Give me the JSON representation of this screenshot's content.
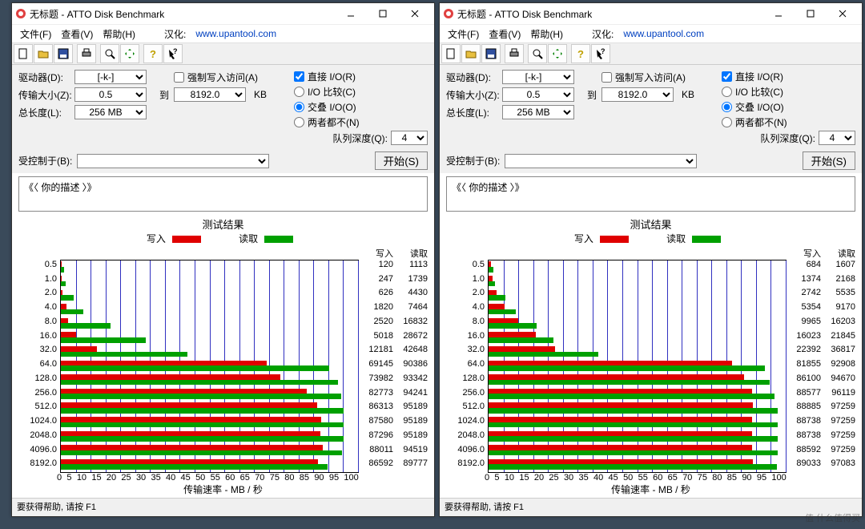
{
  "watermark": "值 什么值得买",
  "title": "无标题 - ATTO Disk Benchmark",
  "menu": {
    "file": "文件(F)",
    "view": "查看(V)",
    "help": "帮助(H)",
    "cn": "汉化:",
    "url": "www.upantool.com"
  },
  "form": {
    "driver_lbl": "驱动器(D):",
    "driver": "[-k-]",
    "force_lbl": "强制写入访问(A)",
    "force": false,
    "direct_lbl": "直接 I/O(R)",
    "direct": true,
    "size_lbl": "传输大小(Z):",
    "size_from": "0.5",
    "to_lbl": "到",
    "size_to": "8192.0",
    "kb": "KB",
    "len_lbl": "总长度(L):",
    "len": "256 MB",
    "io_cmp": "I/O 比较(C)",
    "io_ovl": "交叠 I/O(O)",
    "io_nei": "两者都不(N)",
    "io_sel": "io_ovl",
    "queue_lbl": "队列深度(Q):",
    "queue": "4",
    "limit_lbl": "受控制于(B):",
    "limit": "",
    "start": "开始(S)",
    "desc": "《〈  你的描述   〉》"
  },
  "result": {
    "title": "测试结果",
    "write": "写入",
    "read": "读取",
    "xlab": "传输速率 - MB / 秒",
    "hdr_w": "写入",
    "hdr_r": "读取"
  },
  "status": "要获得帮助, 请按 F1",
  "toolbar_icons": [
    "file-new",
    "file-open",
    "file-save",
    "print",
    "search",
    "move",
    "help",
    "whats-this"
  ],
  "chart_data": [
    {
      "type": "bar",
      "xlabel": "传输速率 - MB / 秒",
      "xlim": [
        0,
        100
      ],
      "xticks": [
        0,
        5,
        10,
        15,
        20,
        25,
        30,
        35,
        40,
        45,
        50,
        55,
        60,
        65,
        70,
        75,
        80,
        85,
        90,
        95,
        100
      ],
      "categories": [
        "0.5",
        "1.0",
        "2.0",
        "4.0",
        "8.0",
        "16.0",
        "32.0",
        "64.0",
        "128.0",
        "256.0",
        "512.0",
        "1024.0",
        "2048.0",
        "4096.0",
        "8192.0"
      ],
      "y_unit": "KB block size",
      "series": [
        {
          "name": "写入",
          "color": "#e00000",
          "unit": "KB/s",
          "values": [
            120,
            247,
            626,
            1820,
            2520,
            5018,
            12181,
            69145,
            73982,
            82773,
            86313,
            87580,
            87296,
            88011,
            86592
          ]
        },
        {
          "name": "读取",
          "color": "#00a000",
          "unit": "KB/s",
          "values": [
            1113,
            1739,
            4430,
            7464,
            16832,
            28672,
            42648,
            90386,
            93342,
            94241,
            95189,
            95189,
            95189,
            94519,
            89777
          ]
        }
      ],
      "bar_scale_max_kbps": 100000
    },
    {
      "type": "bar",
      "xlabel": "传输速率 - MB / 秒",
      "xlim": [
        0,
        100
      ],
      "xticks": [
        0,
        5,
        10,
        15,
        20,
        25,
        30,
        35,
        40,
        45,
        50,
        55,
        60,
        65,
        70,
        75,
        80,
        85,
        90,
        95,
        100
      ],
      "categories": [
        "0.5",
        "1.0",
        "2.0",
        "4.0",
        "8.0",
        "16.0",
        "32.0",
        "64.0",
        "128.0",
        "256.0",
        "512.0",
        "1024.0",
        "2048.0",
        "4096.0",
        "8192.0"
      ],
      "y_unit": "KB block size",
      "series": [
        {
          "name": "写入",
          "color": "#e00000",
          "unit": "KB/s",
          "values": [
            684,
            1374,
            2742,
            5354,
            9965,
            16023,
            22392,
            81855,
            86100,
            88577,
            88885,
            88738,
            88738,
            88592,
            89033
          ]
        },
        {
          "name": "读取",
          "color": "#00a000",
          "unit": "KB/s",
          "values": [
            1607,
            2168,
            5535,
            9170,
            16203,
            21845,
            36817,
            92908,
            94670,
            96119,
            97259,
            97259,
            97259,
            97259,
            97083
          ]
        }
      ],
      "bar_scale_max_kbps": 100000
    }
  ]
}
